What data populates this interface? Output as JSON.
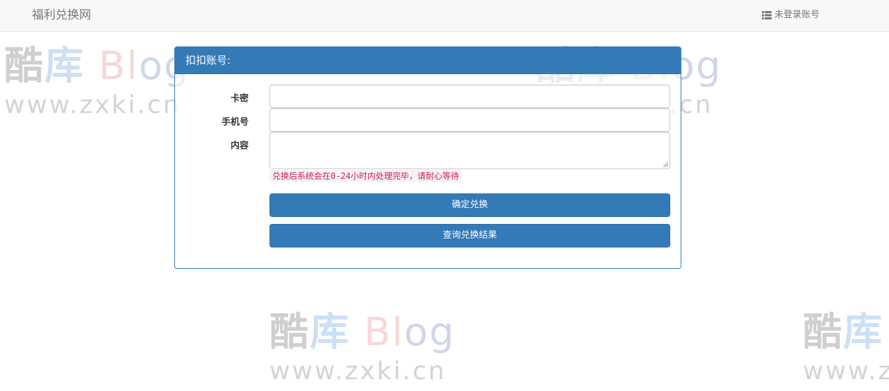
{
  "navbar": {
    "brand": "福利兑换网",
    "user_status": "未登录账号",
    "user_icon": "list-icon"
  },
  "panel": {
    "title": "扣扣账号:",
    "fields": [
      {
        "label": "卡密",
        "value": "",
        "placeholder": ""
      },
      {
        "label": "手机号",
        "value": "",
        "placeholder": ""
      },
      {
        "label": "内容",
        "value": "",
        "placeholder": ""
      }
    ],
    "hint": "兑换后系统会在0-24小时内处理完毕，请耐心等待",
    "submit_label": "确定兑换",
    "query_label": "查询兑换结果"
  },
  "watermark": {
    "logo_parts": [
      "酷",
      "库",
      "Bl",
      "og"
    ],
    "url": "www.zxki.cn"
  },
  "colors": {
    "primary": "#337ab7",
    "hint_text": "#c7254e",
    "hint_bg": "#f9f2f4",
    "navbar_bg": "#f8f8f8"
  }
}
